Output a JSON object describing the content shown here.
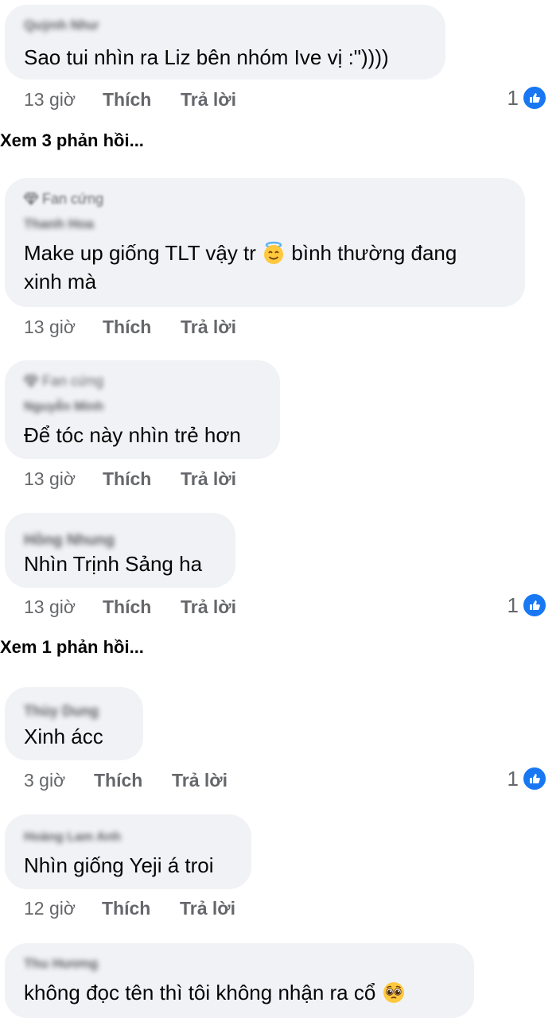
{
  "comments": [
    {
      "author": "Quỳnh Như",
      "text": "Sao tui nhìn ra Liz bên nhóm Ive vị :\"))))",
      "time": "13 giờ",
      "like_label": "Thích",
      "reply_label": "Trả lời",
      "reactions": "1",
      "view_replies": "Xem 3 phản hồi..."
    },
    {
      "badge": "Fan cứng",
      "author": "Thanh Hoa",
      "text_line1": "Make up giống TLT vậy tr",
      "text_line1_end": "bình thường đang",
      "text_line2": "xinh mà",
      "emoji": "smiling-face-with-halo",
      "time": "13 giờ",
      "like_label": "Thích",
      "reply_label": "Trả lời"
    },
    {
      "badge": "Fan cứng",
      "author": "Nguyễn Minh",
      "text": "Để tóc này nhìn trẻ hơn",
      "time": "13 giờ",
      "like_label": "Thích",
      "reply_label": "Trả lời"
    },
    {
      "author": "Hồng Nhung",
      "text": "Nhìn Trịnh Sảng ha",
      "time": "13 giờ",
      "like_label": "Thích",
      "reply_label": "Trả lời",
      "reactions": "1",
      "view_replies": "Xem 1 phản hồi..."
    },
    {
      "author": "Thùy Dung",
      "text": "Xinh ácc",
      "time": "3 giờ",
      "like_label": "Thích",
      "reply_label": "Trả lời",
      "reactions": "1"
    },
    {
      "author": "Hoàng Lam Anh",
      "text": "Nhìn giống Yeji á troi",
      "time": "12 giờ",
      "like_label": "Thích",
      "reply_label": "Trả lời"
    },
    {
      "author": "Thu Hương",
      "text": "không đọc tên thì tôi không nhận ra cổ",
      "emoji": "pleading-face"
    }
  ],
  "colors": {
    "bubble": "#f0f2f5",
    "secondary_text": "#65676b",
    "like_blue": "#1877f2"
  }
}
